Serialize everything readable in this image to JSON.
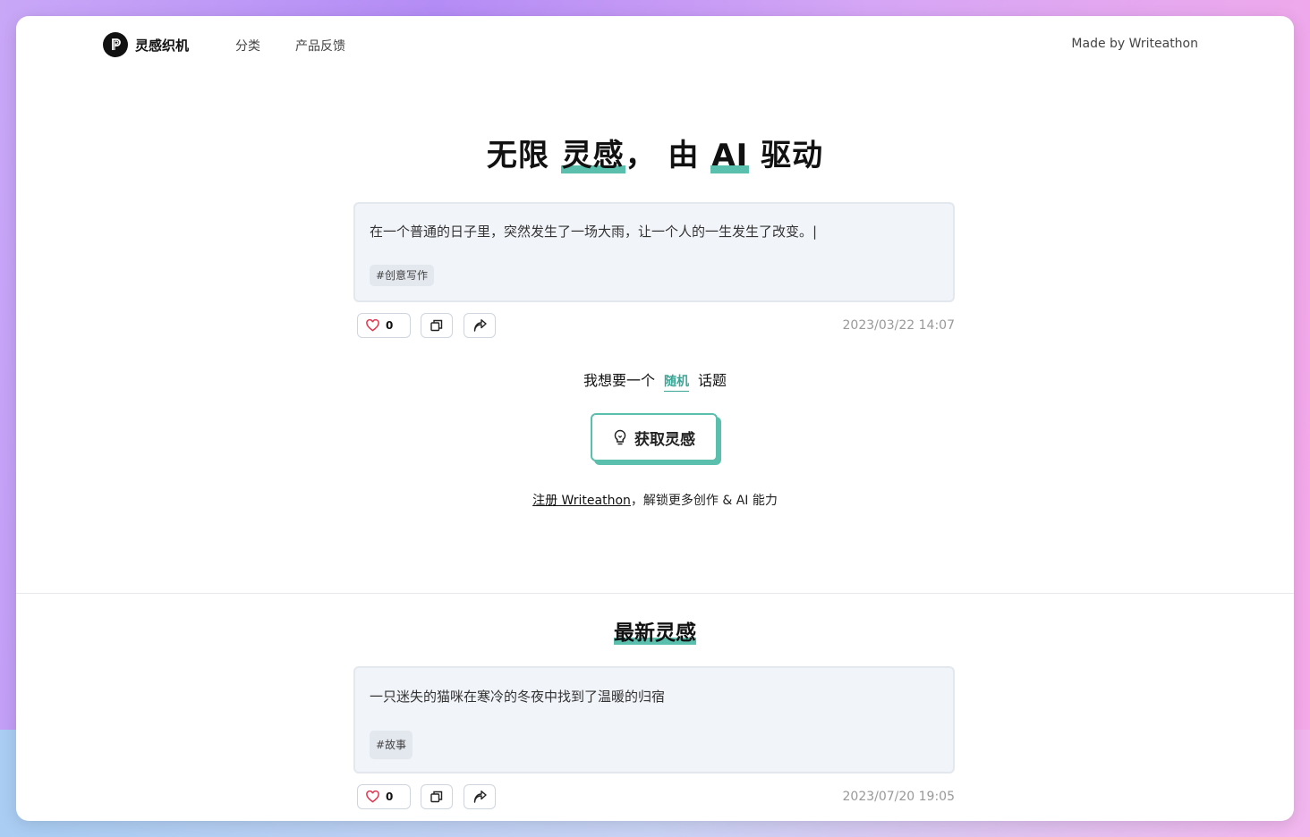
{
  "nav": {
    "logo_text": "灵感织机",
    "links": [
      "分类",
      "产品反馈"
    ],
    "made_by": "Made by Writeathon"
  },
  "hero": {
    "title_parts": [
      "无限 ",
      "灵感",
      "， 由 ",
      "AI",
      " 驱动"
    ]
  },
  "featured": {
    "text": "在一个普通的日子里，突然发生了一场大雨，让一个人的一生发生了改变。|",
    "tag": "#创意写作",
    "likes": "0",
    "timestamp": "2023/03/22 14:07"
  },
  "want": {
    "prefix": "我想要一个",
    "selected": "随机",
    "suffix": "话题"
  },
  "get_button": "获取灵感",
  "register": {
    "link": "注册 Writeathon",
    "rest": "，解锁更多创作 & AI 能力"
  },
  "latest": {
    "title": "最新灵感",
    "items": [
      {
        "text": "一只迷失的猫咪在寒冷的冬夜中找到了温暖的归宿",
        "tag": "#故事",
        "likes": "0",
        "timestamp": "2023/07/20 19:05"
      }
    ]
  },
  "colors": {
    "accent": "#5bbfae",
    "accent_text": "#3aa796",
    "heart": "#e0344a"
  }
}
